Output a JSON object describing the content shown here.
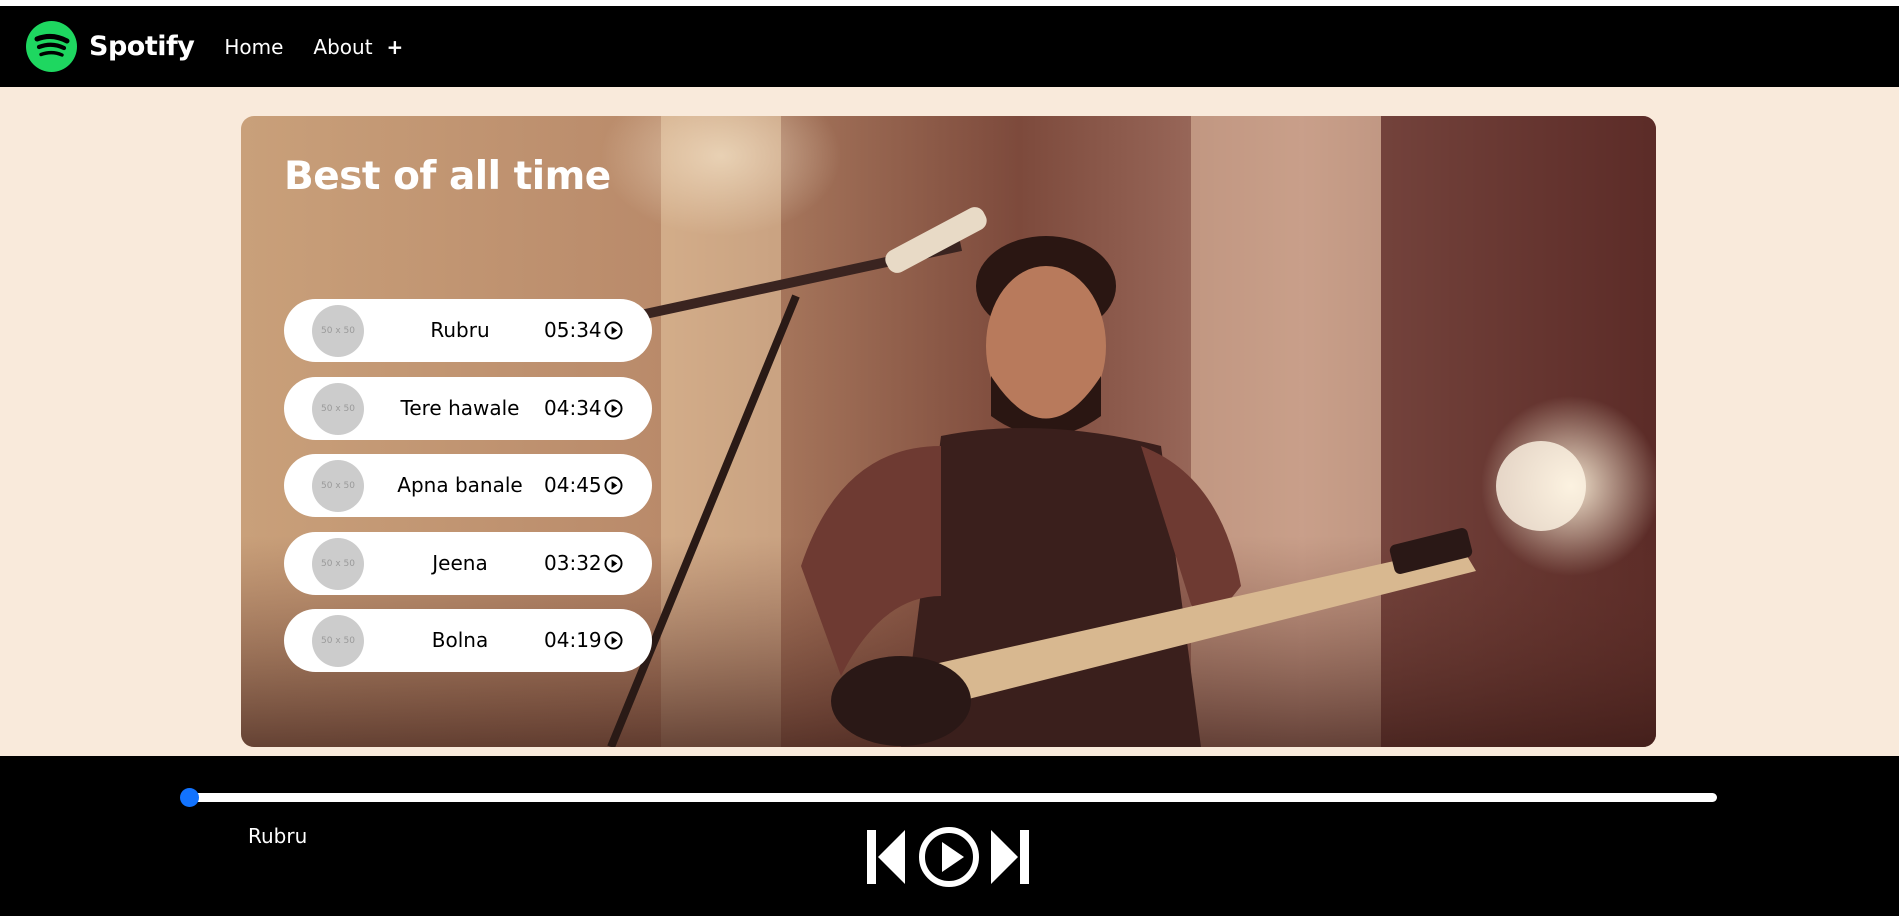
{
  "navbar": {
    "brand": "Spotify",
    "links": [
      "Home",
      "About"
    ],
    "dropdown_icon": "+"
  },
  "hero": {
    "title": "Best of all time",
    "image_alt": "Singer with guitar performing on stage"
  },
  "songs": [
    {
      "thumb": "50 x 50",
      "name": "Rubru",
      "time": "05:34"
    },
    {
      "thumb": "50 x 50",
      "name": "Tere hawale",
      "time": "04:34"
    },
    {
      "thumb": "50 x 50",
      "name": "Apna banale",
      "time": "04:45"
    },
    {
      "thumb": "50 x 50",
      "name": "Jeena",
      "time": "03:32"
    },
    {
      "thumb": "50 x 50",
      "name": "Bolna",
      "time": "04:19"
    }
  ],
  "player": {
    "now_playing": "Rubru",
    "progress": 0.0,
    "controls": [
      "previous-icon",
      "play-icon",
      "next-icon"
    ]
  },
  "colors": {
    "brand_green": "#1ed760",
    "page_bg": "#f9eadb",
    "bar_bg": "#000000",
    "accent_blue": "#0b6cff"
  }
}
